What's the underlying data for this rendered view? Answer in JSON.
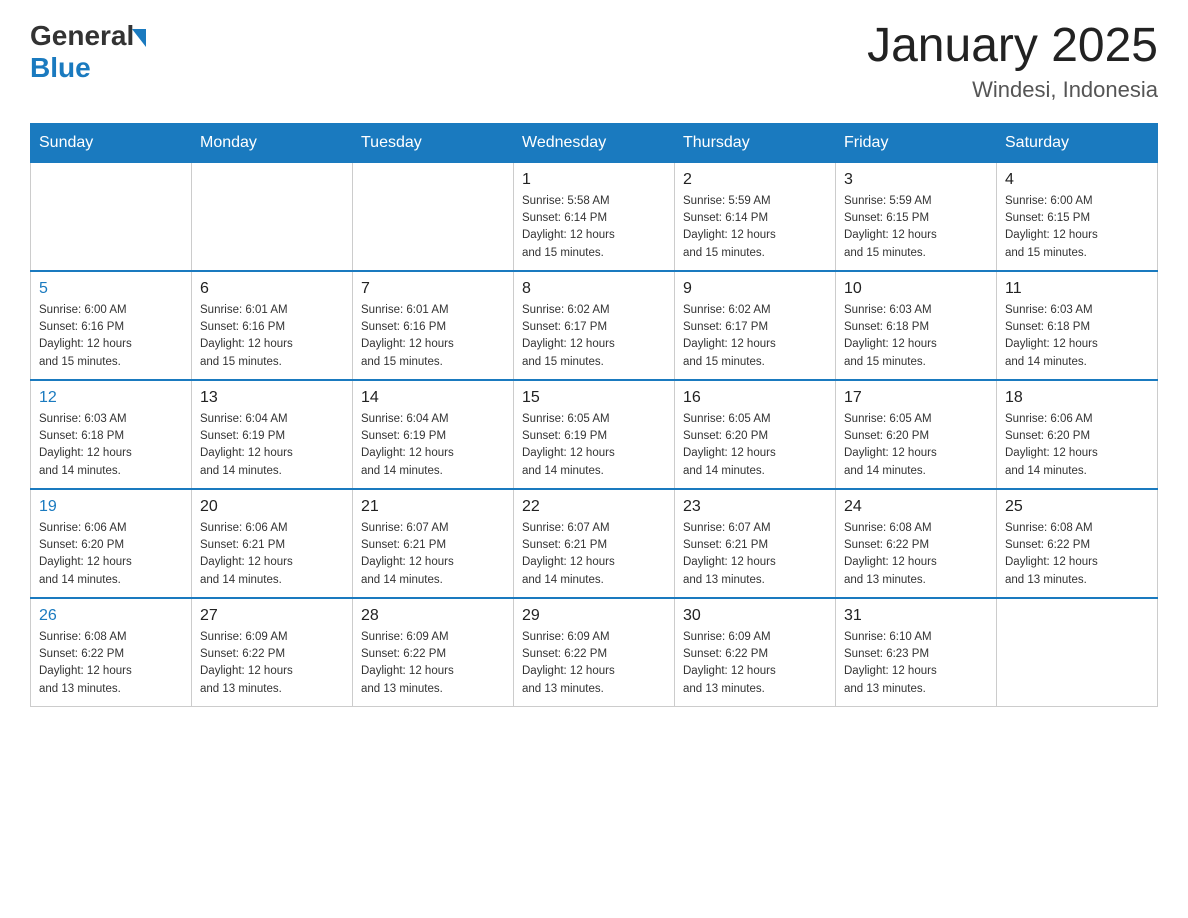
{
  "logo": {
    "general": "General",
    "blue": "Blue"
  },
  "title": "January 2025",
  "subtitle": "Windesi, Indonesia",
  "days": [
    "Sunday",
    "Monday",
    "Tuesday",
    "Wednesday",
    "Thursday",
    "Friday",
    "Saturday"
  ],
  "weeks": [
    [
      {
        "day": "",
        "info": ""
      },
      {
        "day": "",
        "info": ""
      },
      {
        "day": "",
        "info": ""
      },
      {
        "day": "1",
        "info": "Sunrise: 5:58 AM\nSunset: 6:14 PM\nDaylight: 12 hours\nand 15 minutes."
      },
      {
        "day": "2",
        "info": "Sunrise: 5:59 AM\nSunset: 6:14 PM\nDaylight: 12 hours\nand 15 minutes."
      },
      {
        "day": "3",
        "info": "Sunrise: 5:59 AM\nSunset: 6:15 PM\nDaylight: 12 hours\nand 15 minutes."
      },
      {
        "day": "4",
        "info": "Sunrise: 6:00 AM\nSunset: 6:15 PM\nDaylight: 12 hours\nand 15 minutes."
      }
    ],
    [
      {
        "day": "5",
        "info": "Sunrise: 6:00 AM\nSunset: 6:16 PM\nDaylight: 12 hours\nand 15 minutes."
      },
      {
        "day": "6",
        "info": "Sunrise: 6:01 AM\nSunset: 6:16 PM\nDaylight: 12 hours\nand 15 minutes."
      },
      {
        "day": "7",
        "info": "Sunrise: 6:01 AM\nSunset: 6:16 PM\nDaylight: 12 hours\nand 15 minutes."
      },
      {
        "day": "8",
        "info": "Sunrise: 6:02 AM\nSunset: 6:17 PM\nDaylight: 12 hours\nand 15 minutes."
      },
      {
        "day": "9",
        "info": "Sunrise: 6:02 AM\nSunset: 6:17 PM\nDaylight: 12 hours\nand 15 minutes."
      },
      {
        "day": "10",
        "info": "Sunrise: 6:03 AM\nSunset: 6:18 PM\nDaylight: 12 hours\nand 15 minutes."
      },
      {
        "day": "11",
        "info": "Sunrise: 6:03 AM\nSunset: 6:18 PM\nDaylight: 12 hours\nand 14 minutes."
      }
    ],
    [
      {
        "day": "12",
        "info": "Sunrise: 6:03 AM\nSunset: 6:18 PM\nDaylight: 12 hours\nand 14 minutes."
      },
      {
        "day": "13",
        "info": "Sunrise: 6:04 AM\nSunset: 6:19 PM\nDaylight: 12 hours\nand 14 minutes."
      },
      {
        "day": "14",
        "info": "Sunrise: 6:04 AM\nSunset: 6:19 PM\nDaylight: 12 hours\nand 14 minutes."
      },
      {
        "day": "15",
        "info": "Sunrise: 6:05 AM\nSunset: 6:19 PM\nDaylight: 12 hours\nand 14 minutes."
      },
      {
        "day": "16",
        "info": "Sunrise: 6:05 AM\nSunset: 6:20 PM\nDaylight: 12 hours\nand 14 minutes."
      },
      {
        "day": "17",
        "info": "Sunrise: 6:05 AM\nSunset: 6:20 PM\nDaylight: 12 hours\nand 14 minutes."
      },
      {
        "day": "18",
        "info": "Sunrise: 6:06 AM\nSunset: 6:20 PM\nDaylight: 12 hours\nand 14 minutes."
      }
    ],
    [
      {
        "day": "19",
        "info": "Sunrise: 6:06 AM\nSunset: 6:20 PM\nDaylight: 12 hours\nand 14 minutes."
      },
      {
        "day": "20",
        "info": "Sunrise: 6:06 AM\nSunset: 6:21 PM\nDaylight: 12 hours\nand 14 minutes."
      },
      {
        "day": "21",
        "info": "Sunrise: 6:07 AM\nSunset: 6:21 PM\nDaylight: 12 hours\nand 14 minutes."
      },
      {
        "day": "22",
        "info": "Sunrise: 6:07 AM\nSunset: 6:21 PM\nDaylight: 12 hours\nand 14 minutes."
      },
      {
        "day": "23",
        "info": "Sunrise: 6:07 AM\nSunset: 6:21 PM\nDaylight: 12 hours\nand 13 minutes."
      },
      {
        "day": "24",
        "info": "Sunrise: 6:08 AM\nSunset: 6:22 PM\nDaylight: 12 hours\nand 13 minutes."
      },
      {
        "day": "25",
        "info": "Sunrise: 6:08 AM\nSunset: 6:22 PM\nDaylight: 12 hours\nand 13 minutes."
      }
    ],
    [
      {
        "day": "26",
        "info": "Sunrise: 6:08 AM\nSunset: 6:22 PM\nDaylight: 12 hours\nand 13 minutes."
      },
      {
        "day": "27",
        "info": "Sunrise: 6:09 AM\nSunset: 6:22 PM\nDaylight: 12 hours\nand 13 minutes."
      },
      {
        "day": "28",
        "info": "Sunrise: 6:09 AM\nSunset: 6:22 PM\nDaylight: 12 hours\nand 13 minutes."
      },
      {
        "day": "29",
        "info": "Sunrise: 6:09 AM\nSunset: 6:22 PM\nDaylight: 12 hours\nand 13 minutes."
      },
      {
        "day": "30",
        "info": "Sunrise: 6:09 AM\nSunset: 6:22 PM\nDaylight: 12 hours\nand 13 minutes."
      },
      {
        "day": "31",
        "info": "Sunrise: 6:10 AM\nSunset: 6:23 PM\nDaylight: 12 hours\nand 13 minutes."
      },
      {
        "day": "",
        "info": ""
      }
    ]
  ]
}
